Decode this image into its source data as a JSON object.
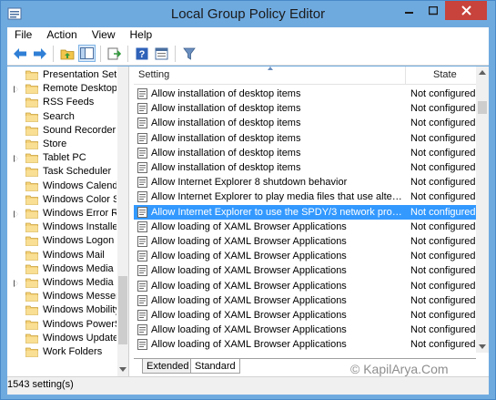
{
  "window": {
    "title": "Local Group Policy Editor"
  },
  "menu": [
    "File",
    "Action",
    "View",
    "Help"
  ],
  "toolbar": {
    "buttons": [
      "back-icon",
      "forward-icon",
      "up-folder-icon",
      "show-hide-tree-icon",
      "export-list-icon",
      "help-icon",
      "properties-icon",
      "filter-icon"
    ]
  },
  "tree": {
    "items": [
      {
        "label": "Presentation Setti",
        "arrow": false
      },
      {
        "label": "Remote Desktop S",
        "arrow": true
      },
      {
        "label": "RSS Feeds",
        "arrow": false
      },
      {
        "label": "Search",
        "arrow": false
      },
      {
        "label": "Sound Recorder",
        "arrow": false
      },
      {
        "label": "Store",
        "arrow": false
      },
      {
        "label": "Tablet PC",
        "arrow": true
      },
      {
        "label": "Task Scheduler",
        "arrow": false
      },
      {
        "label": "Windows Calenda",
        "arrow": false
      },
      {
        "label": "Windows Color Sy",
        "arrow": false
      },
      {
        "label": "Windows Error Re",
        "arrow": true
      },
      {
        "label": "Windows Installer",
        "arrow": false
      },
      {
        "label": "Windows Logon C",
        "arrow": false
      },
      {
        "label": "Windows Mail",
        "arrow": false
      },
      {
        "label": "Windows Media C",
        "arrow": false
      },
      {
        "label": "Windows Media P",
        "arrow": true
      },
      {
        "label": "Windows Messeng",
        "arrow": false
      },
      {
        "label": "Windows Mobility",
        "arrow": false
      },
      {
        "label": "Windows PowerSh",
        "arrow": false
      },
      {
        "label": "Windows Update",
        "arrow": false
      },
      {
        "label": "Work Folders",
        "arrow": false
      }
    ]
  },
  "list": {
    "headers": {
      "setting": "Setting",
      "state": "State"
    },
    "rows": [
      {
        "setting": "Allow installation of desktop items",
        "state": "Not configured"
      },
      {
        "setting": "Allow installation of desktop items",
        "state": "Not configured"
      },
      {
        "setting": "Allow installation of desktop items",
        "state": "Not configured"
      },
      {
        "setting": "Allow installation of desktop items",
        "state": "Not configured"
      },
      {
        "setting": "Allow installation of desktop items",
        "state": "Not configured"
      },
      {
        "setting": "Allow installation of desktop items",
        "state": "Not configured"
      },
      {
        "setting": "Allow Internet Explorer 8 shutdown behavior",
        "state": "Not configured"
      },
      {
        "setting": "Allow Internet Explorer to play media files that use alternativ...",
        "state": "Not configured"
      },
      {
        "setting": "Allow Internet Explorer to use the SPDY/3 network protocol",
        "state": "Not configured",
        "selected": true
      },
      {
        "setting": "Allow loading of XAML Browser Applications",
        "state": "Not configured"
      },
      {
        "setting": "Allow loading of XAML Browser Applications",
        "state": "Not configured"
      },
      {
        "setting": "Allow loading of XAML Browser Applications",
        "state": "Not configured"
      },
      {
        "setting": "Allow loading of XAML Browser Applications",
        "state": "Not configured"
      },
      {
        "setting": "Allow loading of XAML Browser Applications",
        "state": "Not configured"
      },
      {
        "setting": "Allow loading of XAML Browser Applications",
        "state": "Not configured"
      },
      {
        "setting": "Allow loading of XAML Browser Applications",
        "state": "Not configured"
      },
      {
        "setting": "Allow loading of XAML Browser Applications",
        "state": "Not configured"
      },
      {
        "setting": "Allow loading of XAML Browser Applications",
        "state": "Not configured"
      }
    ]
  },
  "tabs": [
    "Extended",
    "Standard"
  ],
  "status": {
    "text": "1543 setting(s)"
  },
  "watermark": "© KapilArya.Com",
  "colors": {
    "titlebar": "#6faadf",
    "selection": "#3399ff",
    "close": "#c7433b",
    "folder": "#f5d27a"
  }
}
